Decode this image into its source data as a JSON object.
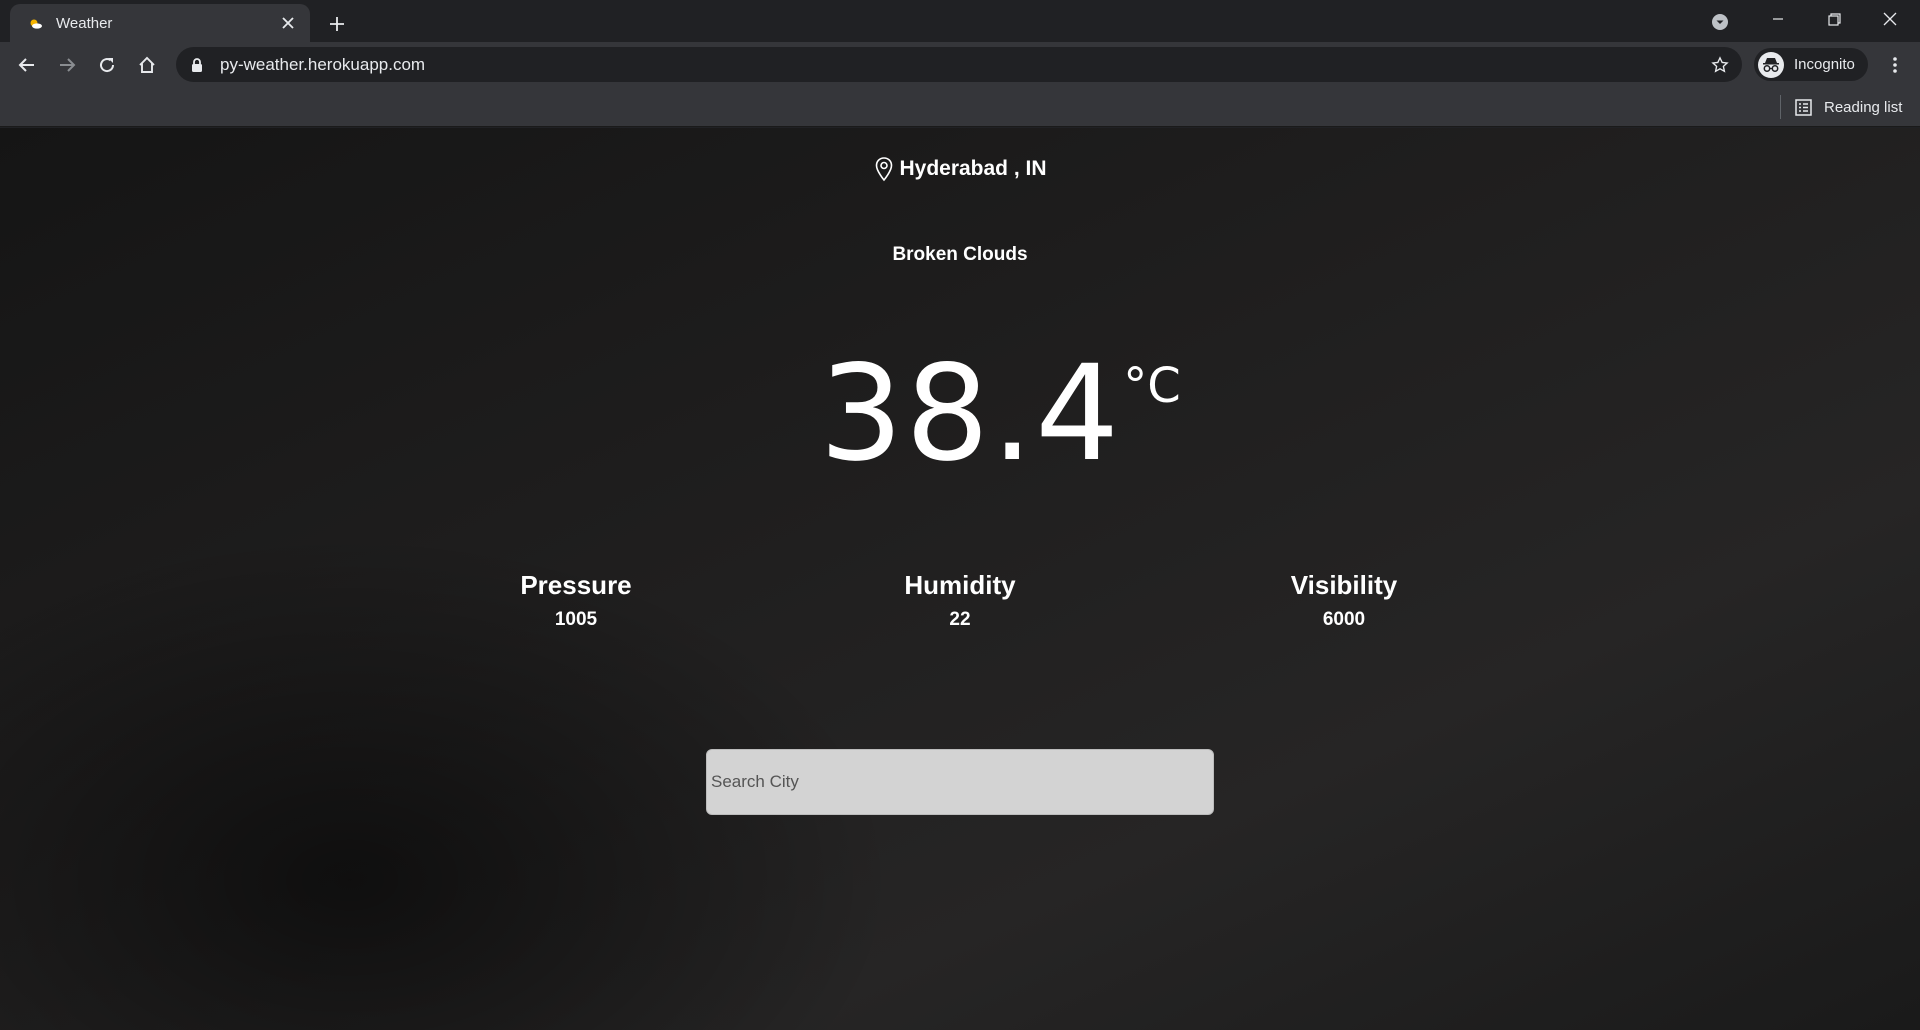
{
  "browser": {
    "tab_title": "Weather",
    "url": "py-weather.herokuapp.com",
    "profile_label": "Incognito",
    "reading_list_label": "Reading list"
  },
  "weather": {
    "city": "Hyderabad , IN",
    "condition": "Broken Clouds",
    "temperature": "38.4",
    "unit": "°C",
    "stats": [
      {
        "label": "Pressure",
        "value": "1005"
      },
      {
        "label": "Humidity",
        "value": "22"
      },
      {
        "label": "Visibility",
        "value": "6000"
      }
    ]
  },
  "search": {
    "placeholder": "Search City",
    "value": ""
  }
}
